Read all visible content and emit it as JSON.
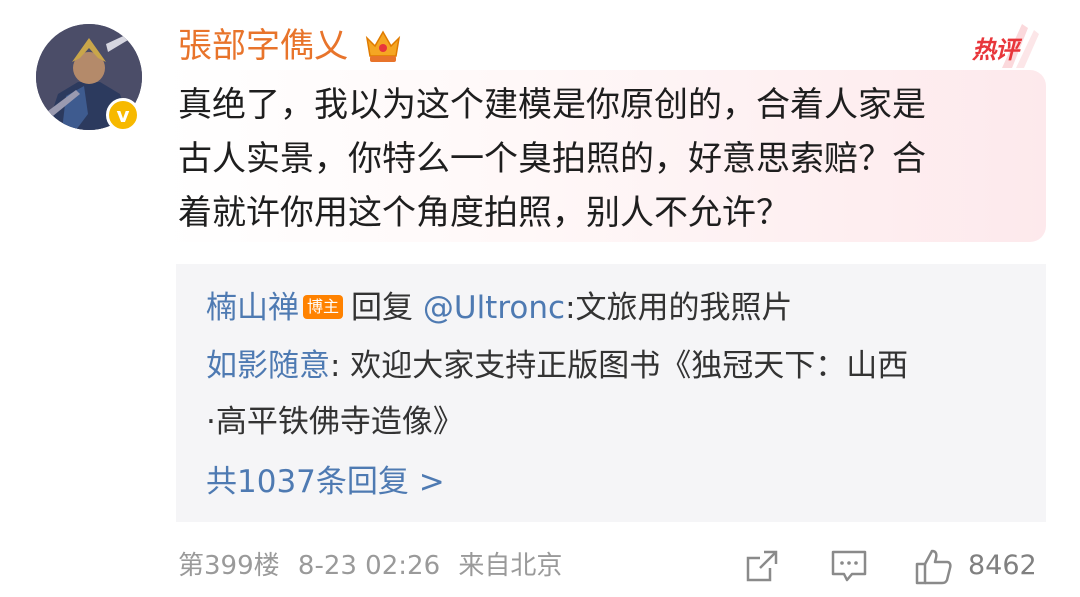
{
  "user": {
    "name": "張部字儁乂",
    "verified_mark": "v"
  },
  "badge": {
    "hot_label": "热评"
  },
  "comment": {
    "line1": "真绝了，我以为这个建模是你原创的，合着人家是",
    "line2": "古人实景，你特么一个臭拍照的，好意思索赔？合",
    "line3": "着就许你用这个角度拍照，别人不允许？"
  },
  "replies": {
    "items": [
      {
        "author": "楠山禅",
        "author_tag": "博主",
        "reply_word": "回复",
        "mention": "@Ultronc",
        "text": ":文旅用的我照片"
      },
      {
        "author": "如影随意",
        "text_line1": ": 欢迎大家支持正版图书《独冠天下：山西",
        "text_line2": "·高平铁佛寺造像》"
      }
    ],
    "more_label": "共1037条回复 >"
  },
  "footer": {
    "floor": "第399楼",
    "date": "8-23 02:26",
    "source": "来自北京",
    "likes": "8462"
  },
  "icons": {
    "crown": "crown-icon",
    "hot": "hot-comment-icon",
    "share": "share-icon",
    "comment": "comment-icon",
    "like": "like-icon"
  },
  "colors": {
    "username": "#e8742b",
    "link": "#4e7ab2",
    "hot": "#e8363b",
    "tag": "#ff8200"
  }
}
